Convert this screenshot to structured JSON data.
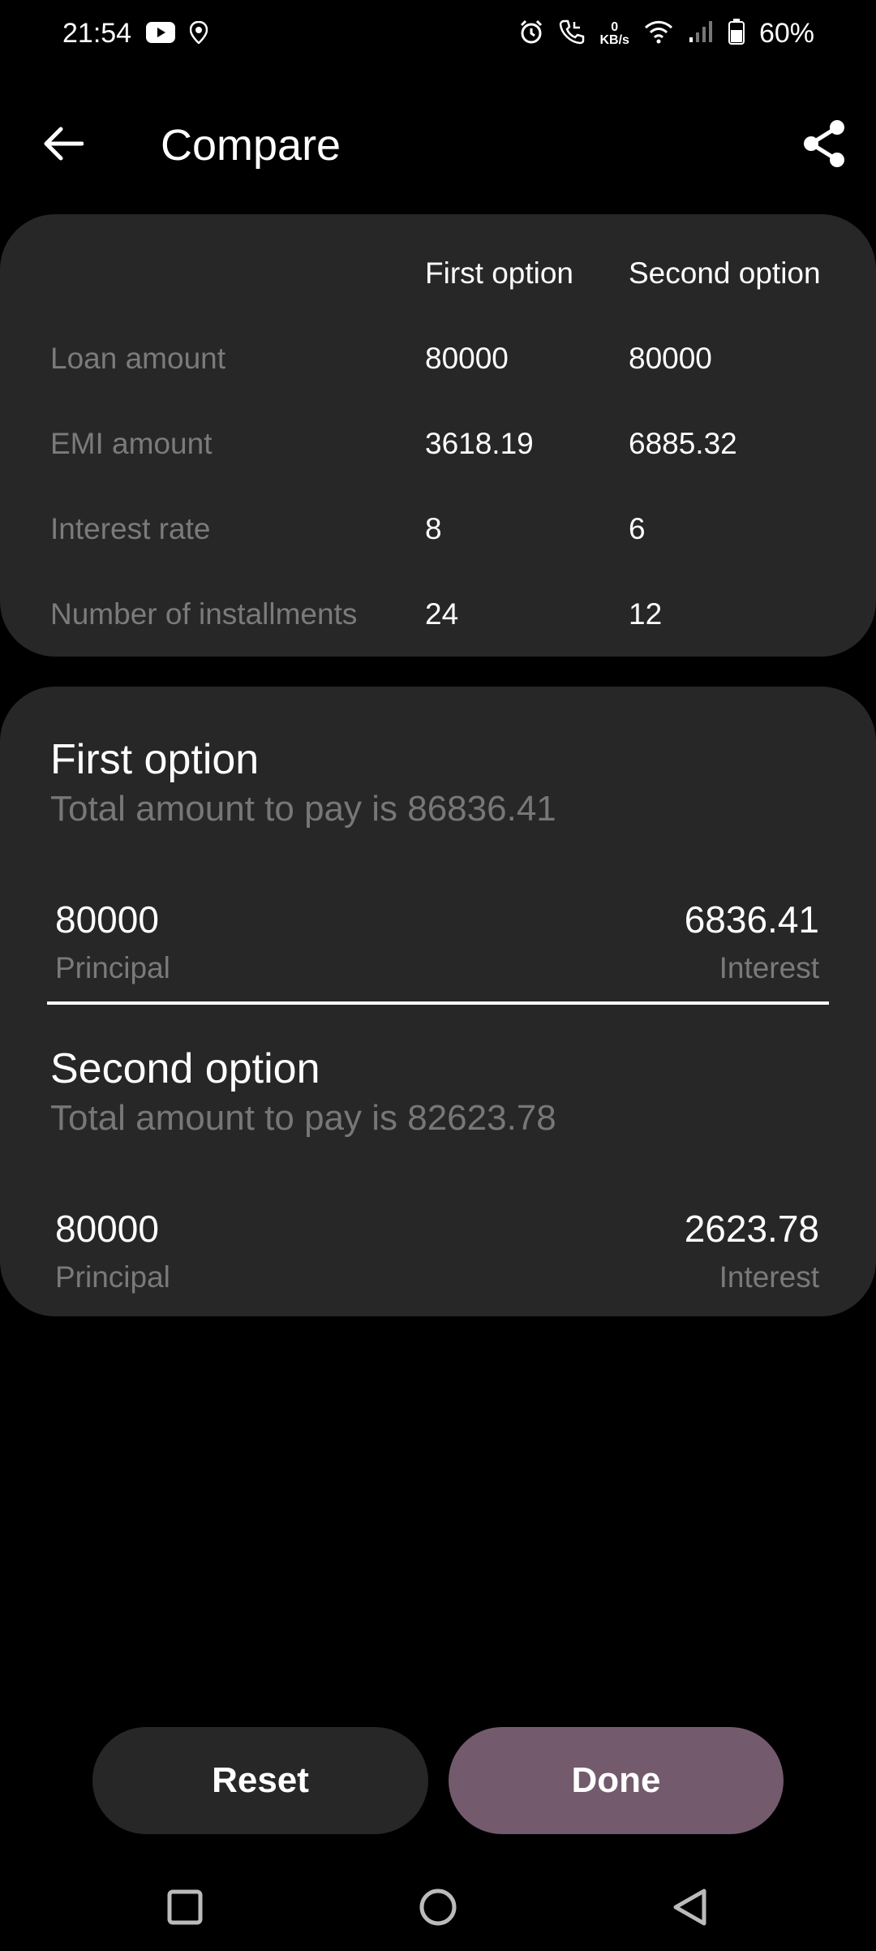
{
  "status_bar": {
    "time": "21:54",
    "left_icons": [
      "youtube-icon",
      "location-icon"
    ],
    "right_icons": [
      "alarm-icon",
      "call-icon",
      "data-speed-icon",
      "wifi-icon",
      "signal-icon",
      "battery-icon"
    ],
    "data_speed_value": "0",
    "data_speed_unit": "KB/s",
    "battery": "60%"
  },
  "app_bar": {
    "title": "Compare",
    "back_icon": "arrow-left-icon",
    "share_icon": "share-icon"
  },
  "comparison": {
    "headers": [
      "First option",
      "Second option"
    ],
    "rows": [
      {
        "label": "Loan amount",
        "first": "80000",
        "second": "80000"
      },
      {
        "label": "EMI amount",
        "first": "3618.19",
        "second": "6885.32"
      },
      {
        "label": "Interest rate",
        "first": "8",
        "second": "6"
      },
      {
        "label": "Number of installments",
        "first": "24",
        "second": "12"
      }
    ]
  },
  "summary": {
    "options": [
      {
        "title": "First option",
        "total_text": "Total amount to pay is 86836.41",
        "principal_value": "80000",
        "principal_label": "Principal",
        "interest_value": "6836.41",
        "interest_label": "Interest"
      },
      {
        "title": "Second option",
        "total_text": "Total amount to pay is 82623.78",
        "principal_value": "80000",
        "principal_label": "Principal",
        "interest_value": "2623.78",
        "interest_label": "Interest"
      }
    ]
  },
  "buttons": {
    "reset": "Reset",
    "done": "Done"
  },
  "colors": {
    "background": "#000000",
    "card": "#272727",
    "done_button": "#735a6c",
    "muted_text": "#7b7b7b"
  },
  "nav_bar": [
    "recents-square-icon",
    "home-circle-icon",
    "back-triangle-icon"
  ]
}
